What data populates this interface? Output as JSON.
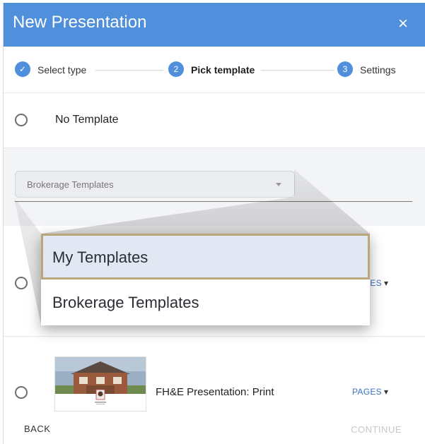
{
  "header": {
    "title": "New Presentation",
    "close_icon": "×"
  },
  "stepper": {
    "steps": [
      {
        "number": "✓",
        "label": "Select type"
      },
      {
        "number": "2",
        "label": "Pick template"
      },
      {
        "number": "3",
        "label": "Settings"
      }
    ]
  },
  "options": {
    "no_template_label": "No Template",
    "pages_label": "PAGES",
    "fhe_label": "FH&E Presentation: Print"
  },
  "template_select": {
    "value": "Brokerage Templates",
    "options": [
      "My Templates",
      "Brokerage Templates"
    ]
  },
  "footer": {
    "back_label": "BACK",
    "continue_label": "CONTINUE"
  },
  "colors": {
    "accent": "#4f8fdc",
    "highlight_border": "#b8a77b",
    "selected_bg": "#e2e7f4"
  }
}
